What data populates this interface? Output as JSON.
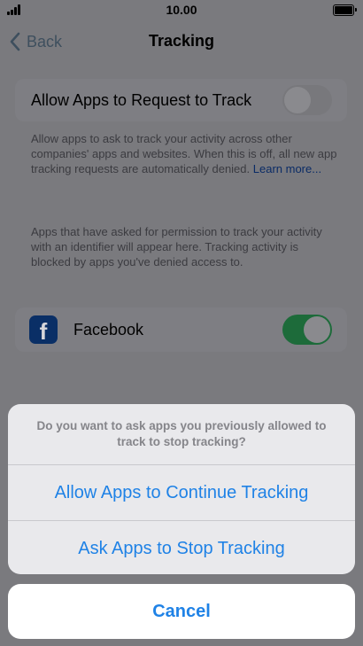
{
  "status": {
    "time": "10.00"
  },
  "nav": {
    "back_label": "Back",
    "title": "Tracking"
  },
  "allow_row": {
    "label": "Allow Apps to Request to Track",
    "enabled": false
  },
  "allow_description": {
    "text": "Allow apps to ask to track your activity across other companies' apps and websites. When this is off, all new app tracking requests are automatically denied.",
    "link": "Learn more..."
  },
  "apps_description": "Apps that have asked for permission to track your activity with an identifier will appear here. Tracking activity is blocked by apps you've denied access to.",
  "apps": [
    {
      "name": "Facebook",
      "icon": "facebook-icon",
      "enabled": true
    }
  ],
  "sheet": {
    "message": "Do you want to ask apps you previously allowed to track to stop tracking?",
    "continue_label": "Allow Apps to Continue Tracking",
    "stop_label": "Ask Apps to Stop Tracking",
    "cancel_label": "Cancel"
  },
  "colors": {
    "accent": "#1f82e6",
    "toggle_on": "#1d6b3a",
    "dim": "#7a7a7e"
  }
}
